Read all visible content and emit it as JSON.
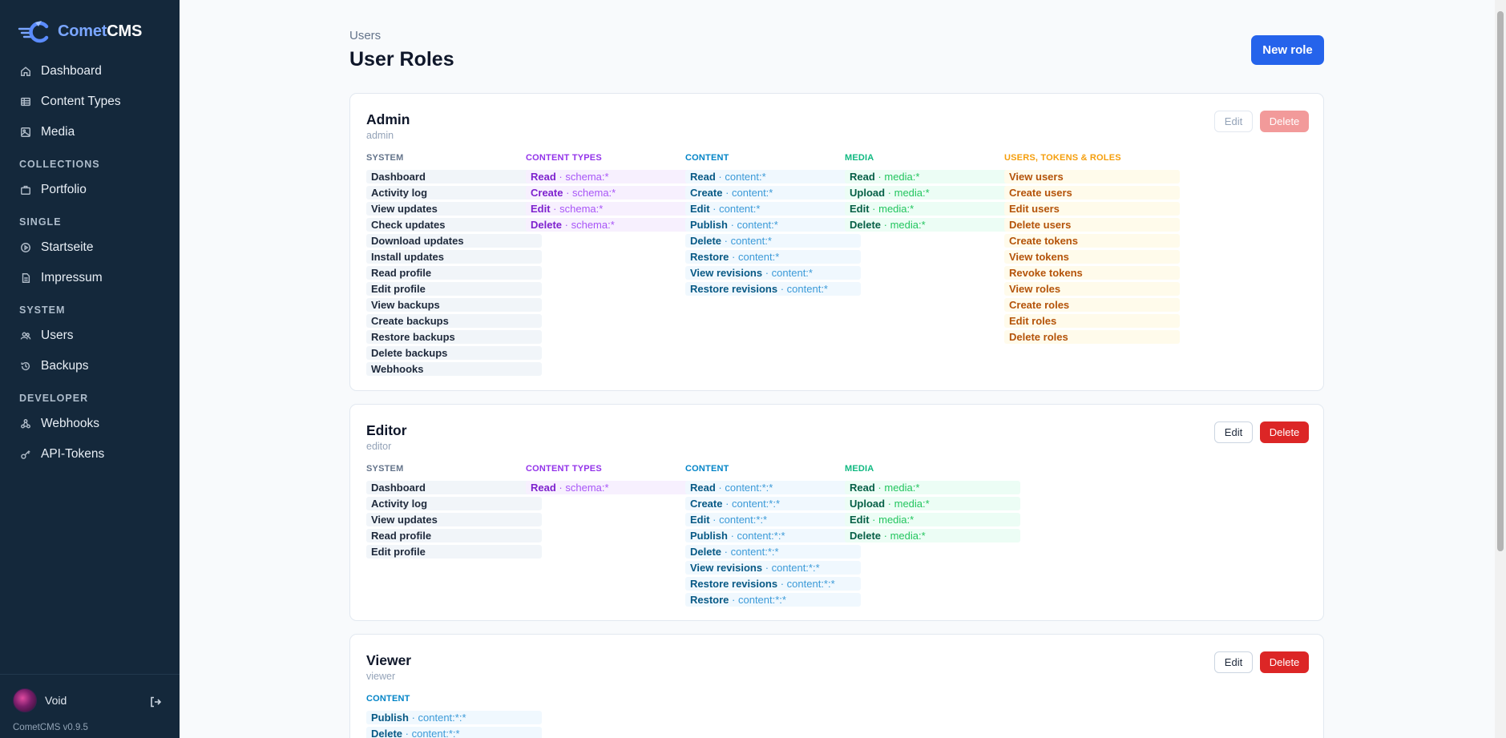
{
  "app": {
    "logo_prefix": "Comet",
    "logo_suffix": "CMS",
    "version": "CometCMS v0.9.5"
  },
  "sidebar": {
    "items_top": [
      {
        "label": "Dashboard",
        "icon": "home-icon"
      },
      {
        "label": "Content Types",
        "icon": "table-icon"
      },
      {
        "label": "Media",
        "icon": "image-icon"
      }
    ],
    "sections": [
      {
        "title": "COLLECTIONS",
        "items": [
          {
            "label": "Portfolio",
            "icon": "briefcase-icon"
          }
        ]
      },
      {
        "title": "SINGLE",
        "items": [
          {
            "label": "Startseite",
            "icon": "circle-play-icon"
          },
          {
            "label": "Impressum",
            "icon": "document-icon"
          }
        ]
      },
      {
        "title": "SYSTEM",
        "items": [
          {
            "label": "Users",
            "icon": "users-icon"
          },
          {
            "label": "Backups",
            "icon": "history-icon"
          }
        ]
      },
      {
        "title": "DEVELOPER",
        "items": [
          {
            "label": "Webhooks",
            "icon": "webhook-icon"
          },
          {
            "label": "API-Tokens",
            "icon": "key-icon"
          }
        ]
      }
    ],
    "user": {
      "name": "Void"
    }
  },
  "header": {
    "breadcrumb": "Users",
    "title": "User Roles",
    "new_role_label": "New role"
  },
  "buttons": {
    "edit": "Edit",
    "delete": "Delete"
  },
  "roles": [
    {
      "name": "Admin",
      "slug": "admin",
      "columns": [
        {
          "title": "SYSTEM",
          "kind": "sys",
          "items": [
            {
              "label": "Dashboard"
            },
            {
              "label": "Activity log"
            },
            {
              "label": "View updates"
            },
            {
              "label": "Check updates"
            },
            {
              "label": "Download updates"
            },
            {
              "label": "Install updates"
            },
            {
              "label": "Read profile"
            },
            {
              "label": "Edit profile"
            },
            {
              "label": "View backups"
            },
            {
              "label": "Create backups"
            },
            {
              "label": "Restore backups"
            },
            {
              "label": "Delete backups"
            },
            {
              "label": "Webhooks"
            }
          ]
        },
        {
          "title": "CONTENT TYPES",
          "kind": "ct",
          "items": [
            {
              "label": "Read",
              "scope": "schema:*"
            },
            {
              "label": "Create",
              "scope": "schema:*"
            },
            {
              "label": "Edit",
              "scope": "schema:*"
            },
            {
              "label": "Delete",
              "scope": "schema:*"
            }
          ]
        },
        {
          "title": "CONTENT",
          "kind": "co",
          "items": [
            {
              "label": "Read",
              "scope": "content:*"
            },
            {
              "label": "Create",
              "scope": "content:*"
            },
            {
              "label": "Edit",
              "scope": "content:*"
            },
            {
              "label": "Publish",
              "scope": "content:*"
            },
            {
              "label": "Delete",
              "scope": "content:*"
            },
            {
              "label": "Restore",
              "scope": "content:*"
            },
            {
              "label": "View revisions",
              "scope": "content:*"
            },
            {
              "label": "Restore revisions",
              "scope": "content:*"
            }
          ]
        },
        {
          "title": "MEDIA",
          "kind": "me",
          "items": [
            {
              "label": "Read",
              "scope": "media:*"
            },
            {
              "label": "Upload",
              "scope": "media:*"
            },
            {
              "label": "Edit",
              "scope": "media:*"
            },
            {
              "label": "Delete",
              "scope": "media:*"
            }
          ]
        },
        {
          "title": "USERS, TOKENS & ROLES",
          "kind": "us",
          "items": [
            {
              "label": "View users"
            },
            {
              "label": "Create users"
            },
            {
              "label": "Edit users"
            },
            {
              "label": "Delete users"
            },
            {
              "label": "Create tokens"
            },
            {
              "label": "View tokens"
            },
            {
              "label": "Revoke tokens"
            },
            {
              "label": "View roles"
            },
            {
              "label": "Create roles"
            },
            {
              "label": "Edit roles"
            },
            {
              "label": "Delete roles"
            }
          ]
        }
      ]
    },
    {
      "name": "Editor",
      "slug": "editor",
      "columns": [
        {
          "title": "SYSTEM",
          "kind": "sys",
          "items": [
            {
              "label": "Dashboard"
            },
            {
              "label": "Activity log"
            },
            {
              "label": "View updates"
            },
            {
              "label": "Read profile"
            },
            {
              "label": "Edit profile"
            }
          ]
        },
        {
          "title": "CONTENT TYPES",
          "kind": "ct",
          "items": [
            {
              "label": "Read",
              "scope": "schema:*"
            }
          ]
        },
        {
          "title": "CONTENT",
          "kind": "co",
          "items": [
            {
              "label": "Read",
              "scope": "content:*:*"
            },
            {
              "label": "Create",
              "scope": "content:*:*"
            },
            {
              "label": "Edit",
              "scope": "content:*:*"
            },
            {
              "label": "Publish",
              "scope": "content:*:*"
            },
            {
              "label": "Delete",
              "scope": "content:*:*"
            },
            {
              "label": "View revisions",
              "scope": "content:*:*"
            },
            {
              "label": "Restore revisions",
              "scope": "content:*:*"
            },
            {
              "label": "Restore",
              "scope": "content:*:*"
            }
          ]
        },
        {
          "title": "MEDIA",
          "kind": "me",
          "items": [
            {
              "label": "Read",
              "scope": "media:*"
            },
            {
              "label": "Upload",
              "scope": "media:*"
            },
            {
              "label": "Edit",
              "scope": "media:*"
            },
            {
              "label": "Delete",
              "scope": "media:*"
            }
          ]
        }
      ]
    },
    {
      "name": "Viewer",
      "slug": "viewer",
      "columns": [
        {
          "title": "CONTENT",
          "kind": "co",
          "items": [
            {
              "label": "Publish",
              "scope": "content:*:*"
            },
            {
              "label": "Delete",
              "scope": "content:*:*"
            }
          ]
        }
      ]
    }
  ]
}
